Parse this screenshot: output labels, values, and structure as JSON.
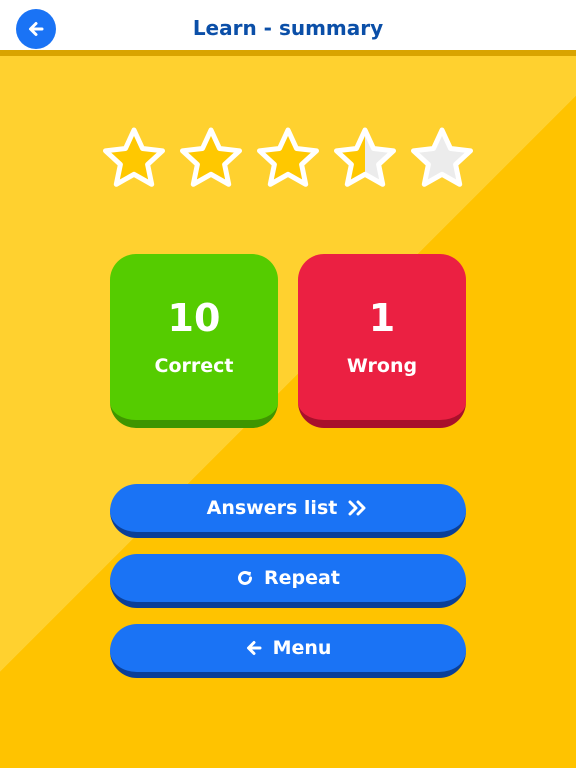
{
  "header": {
    "title": "Learn - summary",
    "back_icon": "arrow-left-icon"
  },
  "rating": {
    "stars_total": 5,
    "stars_value": 3.5
  },
  "results": {
    "correct": {
      "count": "10",
      "label": "Correct",
      "color": "#55cc00"
    },
    "wrong": {
      "count": "1",
      "label": "Wrong",
      "color": "#eb2042"
    }
  },
  "actions": {
    "answers_list": {
      "label": "Answers list",
      "icon": "double-chevron-right-icon"
    },
    "repeat": {
      "label": "Repeat",
      "icon": "refresh-icon"
    },
    "menu": {
      "label": "Menu",
      "icon": "arrow-left-icon"
    }
  },
  "colors": {
    "background": "#ffc300",
    "accent_blue": "#1a73f5",
    "title_blue": "#0b4fa8",
    "star_filled": "#ffc800",
    "star_empty": "#ececec"
  }
}
